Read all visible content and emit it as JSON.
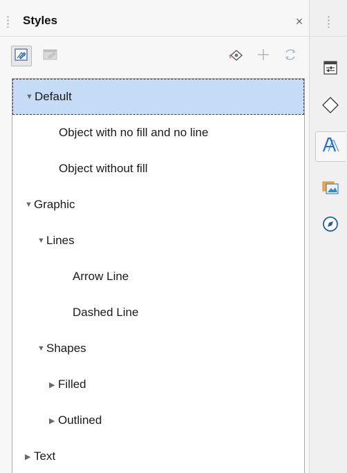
{
  "deck": {
    "title": "Styles",
    "close_symbol": "×"
  },
  "toolbar": {
    "left_buttons": [
      "drawing-styles-icon",
      "presentation-styles-icon"
    ],
    "right_buttons": [
      "fill-format-mode-icon",
      "new-style-icon",
      "update-style-icon"
    ]
  },
  "tree": {
    "items": [
      {
        "label": "Default",
        "expander": "▼",
        "level": 0,
        "selected": true
      },
      {
        "label": "Object with no fill and no line",
        "expander": "",
        "level": 2,
        "selected": false
      },
      {
        "label": "Object without fill",
        "expander": "",
        "level": 2,
        "selected": false
      },
      {
        "label": "Graphic",
        "expander": "▼",
        "level": 0,
        "selected": false
      },
      {
        "label": "Lines",
        "expander": "▼",
        "level": 1,
        "selected": false
      },
      {
        "label": "Arrow Line",
        "expander": "",
        "level": 3,
        "selected": false
      },
      {
        "label": "Dashed Line",
        "expander": "",
        "level": 3,
        "selected": false
      },
      {
        "label": "Shapes",
        "expander": "▼",
        "level": 1,
        "selected": false
      },
      {
        "label": "Filled",
        "expander": "▶",
        "level": 2,
        "selected": false
      },
      {
        "label": "Outlined",
        "expander": "▶",
        "level": 2,
        "selected": false
      },
      {
        "label": "Text",
        "expander": "▶",
        "level": 0,
        "selected": false
      }
    ]
  },
  "sidebar_tabs": [
    {
      "name": "properties-icon",
      "active": false
    },
    {
      "name": "shapes-icon",
      "active": false
    },
    {
      "name": "styles-icon",
      "active": true
    },
    {
      "name": "gallery-icon",
      "active": false
    },
    {
      "name": "navigator-icon",
      "active": false
    }
  ],
  "colors": {
    "selection": "#c6dcf6",
    "accent": "#1e6fd9"
  }
}
